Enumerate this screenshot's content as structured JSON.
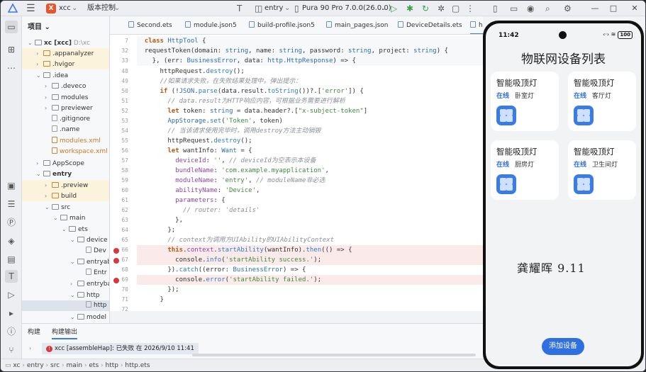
{
  "titlebar": {
    "project_badge": "X",
    "project_name": "xcc",
    "version_control": "版本控制",
    "run_config": "entry",
    "device": "Pura 90 Pro 7.0.0(26.0.0)"
  },
  "project_panel": {
    "title": "项目",
    "rows": [
      {
        "label": "xc [xcc]",
        "extra": "D:\\xc"
      },
      {
        "label": ".appanalyzer"
      },
      {
        "label": ".hvigor"
      },
      {
        "label": ".idea"
      },
      {
        "label": ".deveco"
      },
      {
        "label": "modules"
      },
      {
        "label": "previewer"
      },
      {
        "label": ".gitignore"
      },
      {
        "label": ".name"
      },
      {
        "label": "modules.xml"
      },
      {
        "label": "workspace.xml"
      },
      {
        "label": "AppScope"
      },
      {
        "label": "entry"
      },
      {
        "label": ".preview"
      },
      {
        "label": "build"
      },
      {
        "label": "src"
      },
      {
        "label": "main"
      },
      {
        "label": "ets"
      },
      {
        "label": "device"
      },
      {
        "label": "Dev"
      },
      {
        "label": "entryab"
      },
      {
        "label": "Entr"
      },
      {
        "label": "entryba"
      },
      {
        "label": "http"
      },
      {
        "label": "http"
      },
      {
        "label": "model"
      }
    ]
  },
  "tabs": [
    {
      "label": "Second.ets"
    },
    {
      "label": "module.json5"
    },
    {
      "label": "build-profile.json5"
    },
    {
      "label": "main_pages.json"
    },
    {
      "label": "DeviceDetails.ets"
    },
    {
      "label": "htt"
    }
  ],
  "editor": {
    "line_numbers": [
      "7",
      "32",
      "33",
      "48",
      "49",
      "50",
      "51",
      "52",
      "53",
      "54",
      "55",
      "56",
      "57",
      "58",
      "59",
      "60",
      "61",
      "62",
      "63",
      "64",
      "65",
      "66",
      "67",
      "68",
      "69",
      "70",
      "71",
      "72"
    ],
    "lines": {
      "l7a": "class",
      "l7b": "HttpTool",
      "l7c": " {",
      "l32a": "  requestToken(domain: ",
      "l32b": "string",
      "l32c": ", name: ",
      "l32d": "string",
      "l32e": ", password: ",
      "l32f": "string",
      "l32g": ", project: ",
      "l32h": "string",
      "l32i": ") {",
      "l33a": "    }, (err: ",
      "l33b": "BusinessError",
      "l33c": ", data: ",
      "l33d": "http.HttpResponse",
      "l33e": ") => {",
      "l48a": "      httpRequest.",
      "l48b": "destroy",
      "l48c": "();",
      "l49": "      //如果请求失败，在失败结果处理中，弹出提示：",
      "l50a": "      ",
      "l50b": "if",
      "l50c": " (!",
      "l50d": "JSON",
      "l50e": ".",
      "l50f": "parse",
      "l50g": "(data.result.",
      "l50h": "toString",
      "l50i": "())?.[",
      "l50j": "'error'",
      "l50k": "]) {",
      "l51": "        // data.result为HTTP响应内容，可根据业务需要进行解析",
      "l52a": "        ",
      "l52b": "let",
      "l52c": " token: ",
      "l52d": "string",
      "l52e": " = data.header?.[",
      "l52f": "\"x-subject-token\"",
      "l52g": "]",
      "l53a": "        ",
      "l53b": "AppStorage",
      "l53c": ".",
      "l53d": "set",
      "l53e": "(",
      "l53f": "'Token'",
      "l53g": ", token)",
      "l54": "        // 当该请求使用完毕时，调用destroy方法主动销毁",
      "l55a": "        httpRequest.",
      "l55b": "destroy",
      "l55c": "();",
      "l56a": "        ",
      "l56b": "let",
      "l56c": " wantInfo: ",
      "l56d": "Want",
      "l56e": " = {",
      "l57a": "          ",
      "l57b": "deviceId",
      "l57c": ": ",
      "l57d": "''",
      "l57e": ", ",
      "l57f": "// deviceId为空表示本设备",
      "l58a": "          ",
      "l58b": "bundleName",
      "l58c": ": ",
      "l58d": "'com.example.myapplication'",
      "l58e": ",",
      "l59a": "          ",
      "l59b": "moduleName",
      "l59c": ": ",
      "l59d": "'entry'",
      "l59e": ", ",
      "l59f": "// moduleName非必选",
      "l60a": "          ",
      "l60b": "abilityName",
      "l60c": ": ",
      "l60d": "'Device'",
      "l60e": ",",
      "l61a": "          ",
      "l61b": "parameters",
      "l61c": ": {",
      "l62": "            // router: 'details'",
      "l63": "          },",
      "l64": "        };",
      "l65": "        // context为调用方UIAbility的UIAbilityContext",
      "l66a": "        ",
      "l66b": "this",
      "l66c": ".",
      "l66d": "context",
      "l66e": ".",
      "l66f": "startAbility",
      "l66g": "(wantInfo).",
      "l66h": "then",
      "l66i": "(() => {",
      "l67a": "          console.",
      "l67b": "info",
      "l67c": "(",
      "l67d": "'startAbility success.'",
      "l67e": ");",
      "l68a": "        }).",
      "l68b": "catch",
      "l68c": "((error: ",
      "l68d": "BusinessError",
      "l68e": ") => {",
      "l69a": "          console.",
      "l69b": "error",
      "l69c": "(",
      "l69d": "'startAbility failed.'",
      "l69e": ");",
      "l70": "        });",
      "l71": "      }",
      "l72": ""
    }
  },
  "bottom": {
    "tab_build": "构建",
    "tab_output": "构建输出",
    "message": "xcc [assembleHap]: 已失败 在 2026/9/10 11:41"
  },
  "statusbar": {
    "breadcrumb": [
      "xc",
      "entry",
      "src",
      "main",
      "ets",
      "http",
      "http.ets"
    ]
  },
  "phone": {
    "time": "11:42",
    "battery": "100",
    "title": "物联网设备列表",
    "cards": [
      {
        "name": "智能吸顶灯",
        "status": "在线",
        "room": "卧室灯"
      },
      {
        "name": "智能吸顶灯",
        "status": "在线",
        "room": "客厅灯"
      },
      {
        "name": "智能吸顶灯",
        "status": "在线",
        "room": "厨房灯"
      },
      {
        "name": "智能吸顶灯",
        "status": "在线",
        "room": "卫生间灯"
      }
    ],
    "signature": "龚耀晖 9.11",
    "add_button": "添加设备"
  },
  "colors": {
    "accent": "#3e7be6",
    "error": "#d9363e",
    "phone_button": "#2f6fe0"
  }
}
